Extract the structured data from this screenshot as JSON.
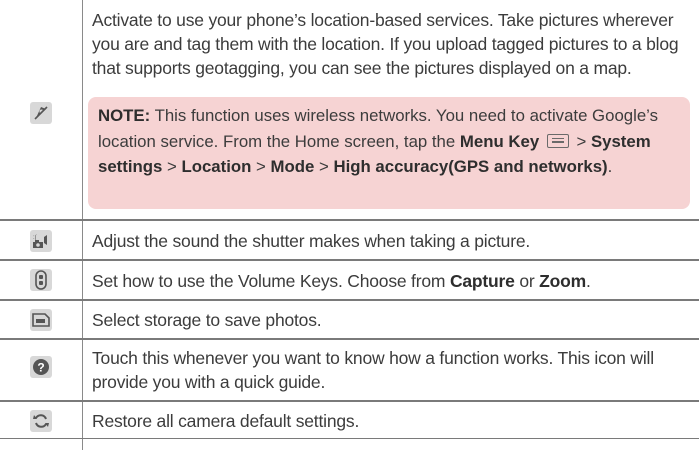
{
  "rows": [
    {
      "icon": "location-tag-icon",
      "text": "Activate to use your phone’s location-based services. Take pictures wherever you are and tag them with the location. If you upload tagged pictures to a blog that supports geotagging, you can see the pictures displayed on a map.",
      "note": {
        "label": "NOTE:",
        "text1": " This function uses wireless networks. You need to activate Google’s location service. From the Home screen, tap the ",
        "menu_key": "Menu Key",
        "sep1": " > ",
        "system_settings": "System settings",
        "sep2": " > ",
        "location": "Location",
        "sep3": " > ",
        "mode": "Mode",
        "sep4": " > ",
        "high_accuracy": "High accuracy(GPS and networks)",
        "end": "."
      }
    },
    {
      "icon": "shutter-sound-icon",
      "text": "Adjust the sound the shutter makes when taking a picture."
    },
    {
      "icon": "volume-key-icon",
      "text_pre": "Set how to use the Volume Keys. Choose from ",
      "opt1": "Capture",
      "text_mid": " or ",
      "opt2": "Zoom",
      "text_end": "."
    },
    {
      "icon": "storage-icon",
      "text": "Select storage to save photos."
    },
    {
      "icon": "help-icon",
      "text": "Touch this whenever you want to know how a function works. This icon will provide you with a quick guide."
    },
    {
      "icon": "reset-icon",
      "text": "Restore all camera default settings."
    }
  ],
  "colors": {
    "note_bg": "#f6d3d3",
    "rule": "#7a7a7a",
    "icon_bg": "#d8d8d8"
  }
}
